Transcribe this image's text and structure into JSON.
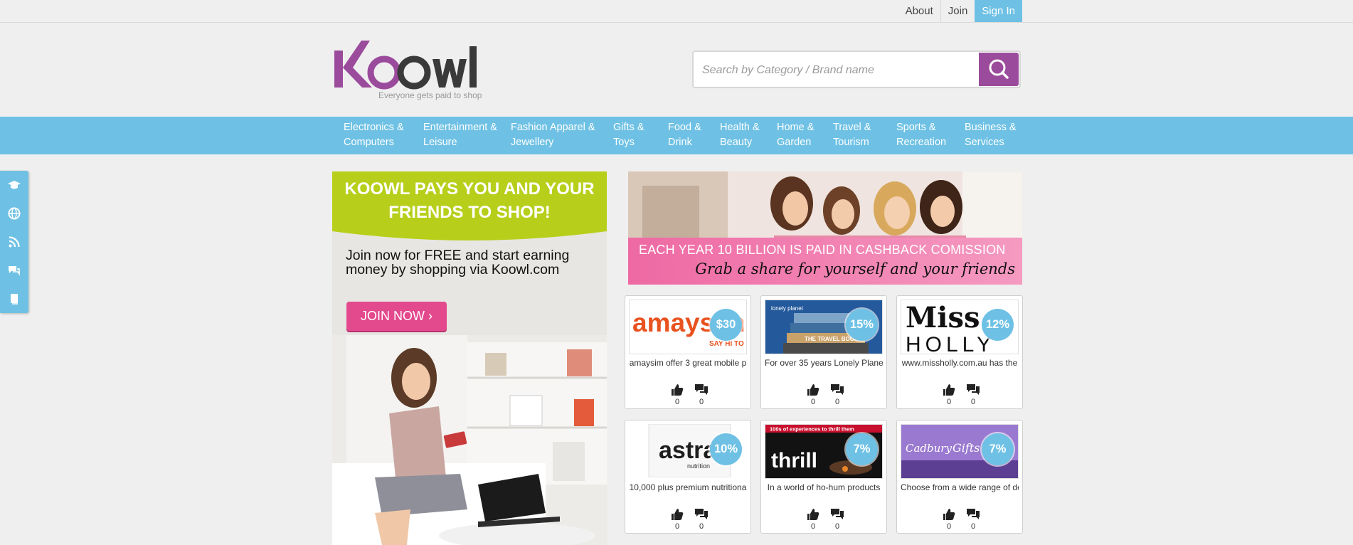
{
  "topnav": {
    "about": "About",
    "join": "Join",
    "signin": "Sign In"
  },
  "logo": {
    "wordmark": "Koowl",
    "tagline": "Everyone gets paid to shop"
  },
  "search": {
    "placeholder": "Search by Category / Brand name"
  },
  "nav": [
    {
      "line1": "Electronics &",
      "line2": "Computers"
    },
    {
      "line1": "Entertainment &",
      "line2": "Leisure"
    },
    {
      "line1": "Fashion Apparel &",
      "line2": "Jewellery"
    },
    {
      "line1": "Gifts &",
      "line2": "Toys"
    },
    {
      "line1": "Food &",
      "line2": "Drink"
    },
    {
      "line1": "Health &",
      "line2": "Beauty"
    },
    {
      "line1": "Home &",
      "line2": "Garden"
    },
    {
      "line1": "Travel &",
      "line2": "Tourism"
    },
    {
      "line1": "Sports &",
      "line2": "Recreation"
    },
    {
      "line1": "Business &",
      "line2": "Services"
    }
  ],
  "sidebar": [
    "graduation-cap-icon",
    "globe-icon",
    "rss-icon",
    "chat-icon",
    "book-icon"
  ],
  "promo": {
    "title_line1": "KOOWL PAYS YOU AND YOUR",
    "title_line2": "FRIENDS TO SHOP!",
    "text": "Join now for FREE and start earning money by shopping via Koowl.com",
    "button": "JOIN NOW"
  },
  "banner": {
    "line1": "EACH YEAR 10 BILLION IS PAID IN CASHBACK COMISSION",
    "line2": "Grab a share for yourself and your friends"
  },
  "colors": {
    "accent": "#6ec1e4",
    "brand_purple": "#9b4b9c",
    "pink": "#e3498d",
    "lime": "#b7cf1a"
  },
  "cards": [
    {
      "brand": "amaysim",
      "sub": "SAY HI TO MORE",
      "badge": "$30",
      "desc": "amaysim offer 3 great mobile p",
      "likes": "0",
      "comments": "0"
    },
    {
      "brand": "lonely planet",
      "sub": "THE TRAVEL BOOK",
      "badge": "15%",
      "desc": "For over 35 years Lonely Plane",
      "likes": "0",
      "comments": "0"
    },
    {
      "brand": "Miss",
      "sub": "HOLLY",
      "badge": "12%",
      "desc": "www.missholly.com.au has the",
      "likes": "0",
      "comments": "0"
    },
    {
      "brand": "astra",
      "sub": "nutrition",
      "badge": "10%",
      "desc": "10,000 plus premium nutritiona",
      "likes": "0",
      "comments": "0"
    },
    {
      "brand": "thrill",
      "sub": "100s of experiences to thrill them",
      "badge": "7%",
      "desc": "In a world of ho-hum products",
      "likes": "0",
      "comments": "0"
    },
    {
      "brand": "Cadbury",
      "sub": "Gifts",
      "badge": "7%",
      "desc": "Choose from a wide range of de",
      "likes": "0",
      "comments": "0"
    }
  ]
}
